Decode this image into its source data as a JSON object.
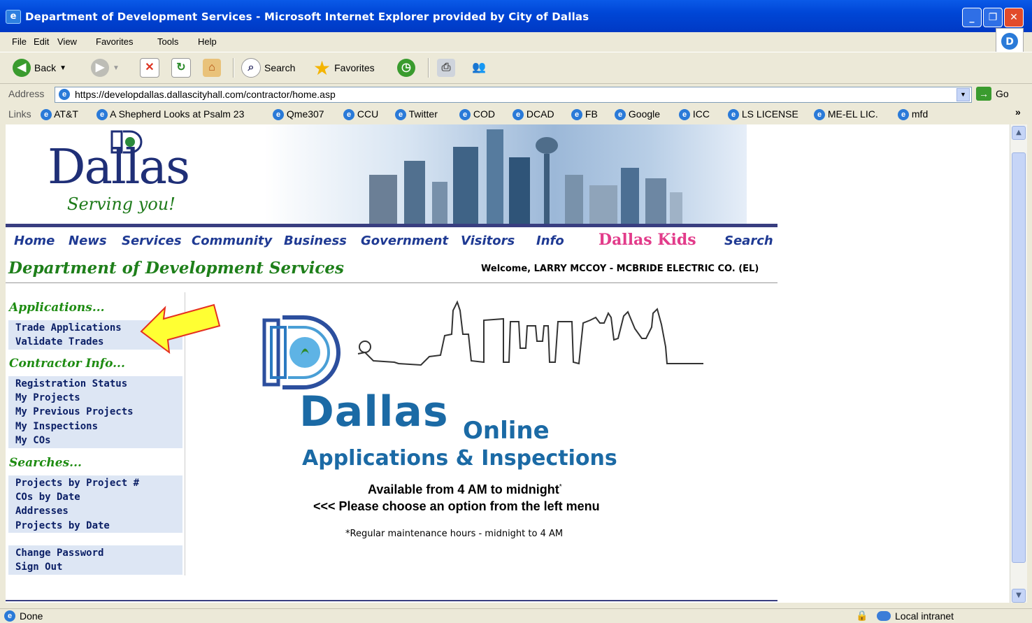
{
  "window": {
    "title": "Department of Development Services - Microsoft Internet Explorer provided by City of Dallas"
  },
  "menu": [
    "File",
    "Edit",
    "View",
    "Favorites",
    "Tools",
    "Help"
  ],
  "toolbar": {
    "back": "Back",
    "search": "Search",
    "favorites": "Favorites"
  },
  "address": {
    "label": "Address",
    "url": "https://developdallas.dallascityhall.com/contractor/home.asp",
    "go": "Go"
  },
  "links": {
    "label": "Links",
    "items": [
      "AT&T",
      "A Shepherd Looks at Psalm 23",
      "Qme307",
      "CCU",
      "Twitter",
      "COD",
      "DCAD",
      "FB",
      "Google",
      "ICC",
      "LS LICENSE",
      "ME-EL LIC.",
      "mfd"
    ],
    "more": "»"
  },
  "banner": {
    "logo_text": "Dallas",
    "tagline": "Serving you!"
  },
  "nav": [
    "Home",
    "News",
    "Services",
    "Community",
    "Business",
    "Government",
    "Visitors",
    "Info",
    "Dallas Kids",
    "Search"
  ],
  "page": {
    "department": "Department of Development Services",
    "welcome": "Welcome, LARRY MCCOY - MCBRIDE ELECTRIC CO. (EL)"
  },
  "sidebar": {
    "applications_heading": "Applications...",
    "applications": [
      "Trade Applications",
      "Validate Trades"
    ],
    "contractor_heading": "Contractor Info...",
    "contractor": [
      "Registration Status",
      "My Projects",
      "My Previous Projects",
      "My Inspections",
      "My COs"
    ],
    "searches_heading": "Searches...",
    "searches": [
      "Projects by Project #",
      "COs by Date",
      "Addresses",
      "Projects by Date"
    ],
    "account": [
      "Change Password",
      "Sign Out"
    ]
  },
  "main": {
    "logo_word": "Dallas",
    "logo_sub": "Online",
    "headline": "Applications & Inspections",
    "availability": "Available from 4 AM to midnight",
    "availability_mark": "*",
    "instruction": "<<< Please choose an option from the left menu",
    "note": "*Regular maintenance hours - midnight to 4 AM"
  },
  "status": {
    "left": "Done",
    "zone": "Local intranet"
  },
  "colors": {
    "nav_text": "#1f3a93",
    "green_heading": "#1e7f1a",
    "sidebar_bg": "#dde6f4",
    "accent_blue": "#1b6aa5",
    "arrow_yellow": "#ffff33"
  }
}
